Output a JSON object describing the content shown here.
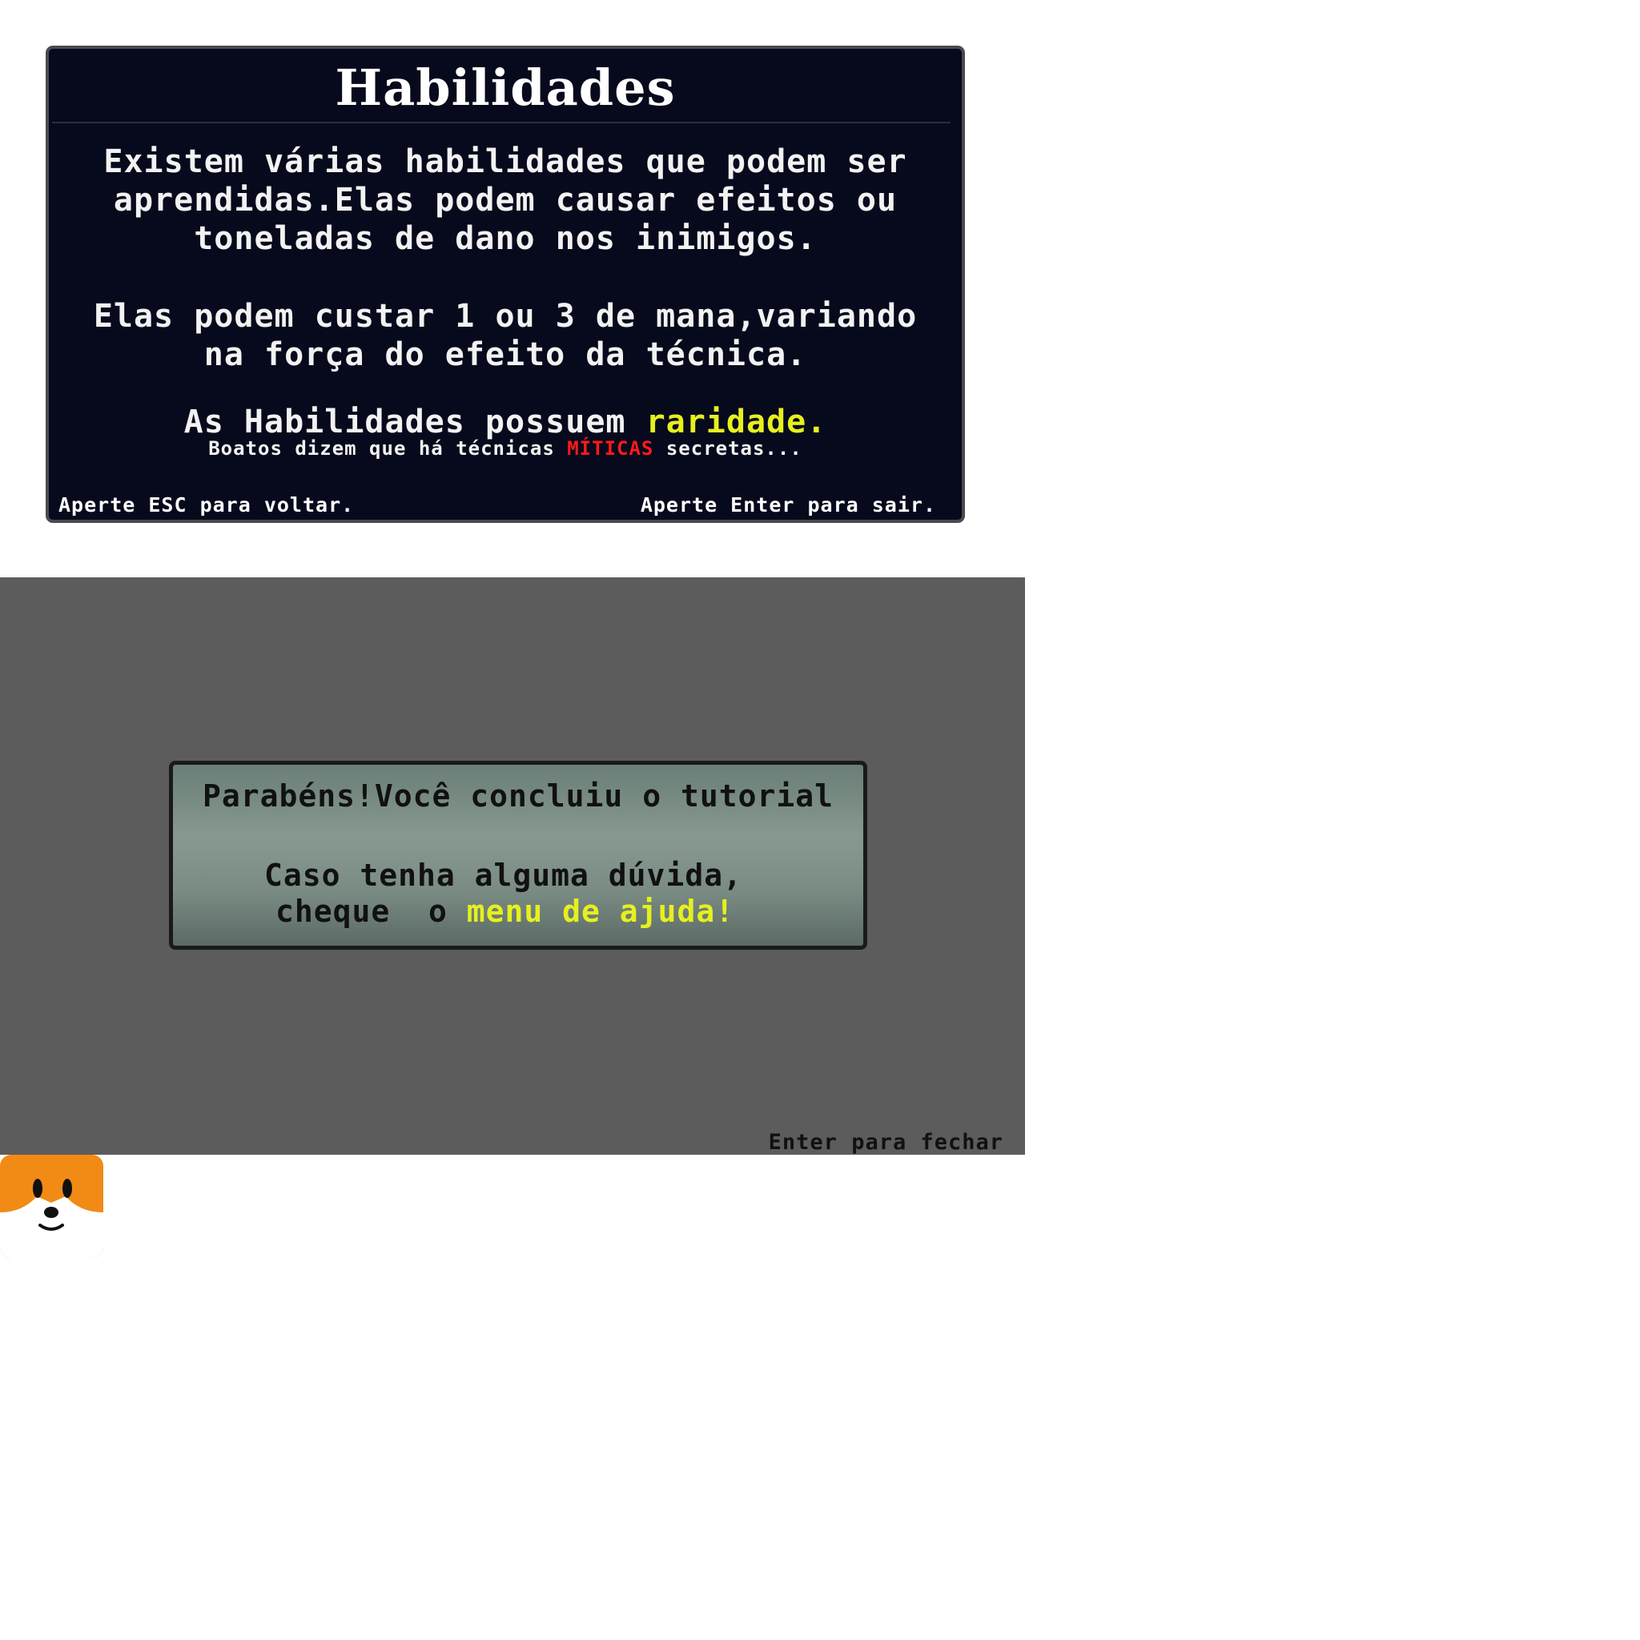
{
  "skills_panel": {
    "title": "Habilidades",
    "para1": "Existem várias habilidades que podem ser aprendidas.Elas podem causar efeitos ou toneladas de dano nos inimigos.",
    "para2": "Elas podem custar 1 ou 3 de mana,variando na força do efeito da técnica.",
    "rarity_prefix": "As Habilidades possuem ",
    "rarity_highlight": "raridade.",
    "rumor_prefix": "Boatos dizem que há técnicas ",
    "rumor_highlight": "MÍTICAS",
    "rumor_suffix": " secretas...",
    "hint_back": "Aperte ESC para voltar.",
    "hint_exit": "Aperte Enter para sair."
  },
  "tutorial_overlay": {
    "title": "Parabéns!Você concluiu o tutorial",
    "doubt": "Caso tenha alguma dúvida,",
    "check_prefix": "cheque  o ",
    "check_highlight": "menu de ajuda!",
    "close_hint": "Enter para fechar"
  },
  "avatar": {
    "icon": "fox-face-icon"
  },
  "colors": {
    "panel_bg": "#070a1c",
    "panel_border": "#4a4a4f",
    "highlight_yellow": "#e6f01e",
    "highlight_red": "#ff1a1a",
    "overlay_bg": "#5c5c5c",
    "fox_orange": "#f28a16"
  }
}
